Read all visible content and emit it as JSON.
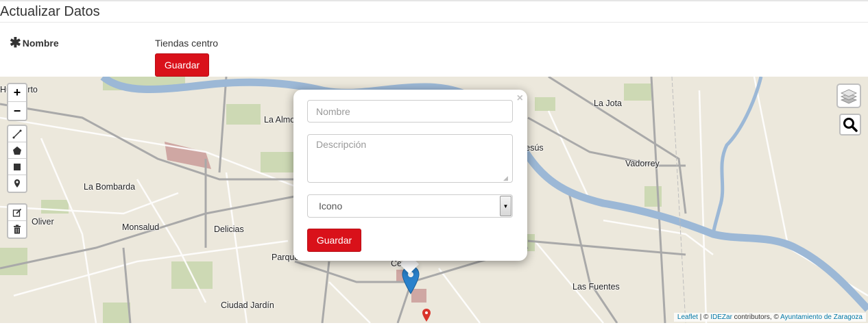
{
  "page": {
    "title": "Actualizar Datos"
  },
  "form": {
    "nombre_label": "Nombre",
    "nombre_value": "Tiendas centro",
    "save_label": "Guardar"
  },
  "map": {
    "places": [
      "Humberto",
      "La Almozara",
      "La Bombarda",
      "Oliver",
      "Monsalud",
      "Delicias",
      "Parque",
      "Ciudad Jardín",
      "Centro",
      "Jesús",
      "La Jota",
      "Vadorrey",
      "Las Fuentes"
    ],
    "zoom_in": "+",
    "zoom_out": "−",
    "attribution": {
      "leaflet": "Leaflet",
      "sep": " | © ",
      "idezar": "IDEZar",
      "contributors": " contributors, © ",
      "ayuntamiento": "Ayuntamiento de Zaragoza",
      "watermark": "IDEZar"
    }
  },
  "popup": {
    "nombre_placeholder": "Nombre",
    "descripcion_placeholder": "Descripción",
    "icono_selected": "Icono",
    "save_label": "Guardar",
    "close": "×"
  },
  "colors": {
    "accent": "#d9111a",
    "river": "#9cb8d6",
    "marker": "#2a81cb"
  }
}
